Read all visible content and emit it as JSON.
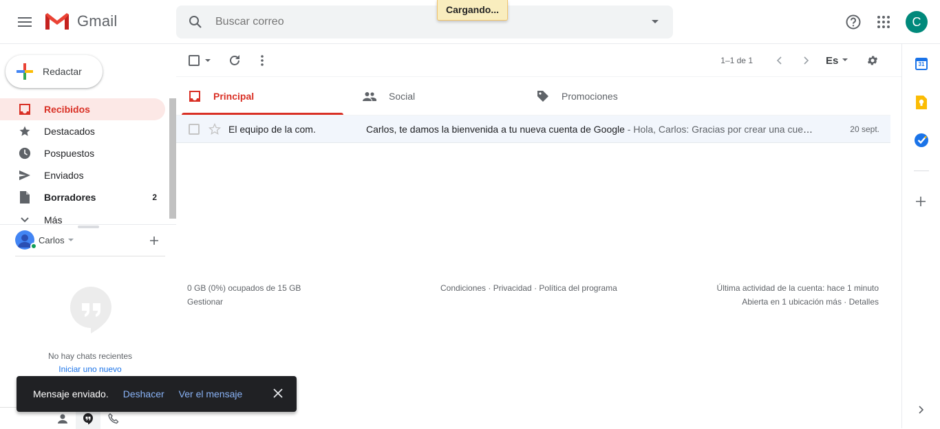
{
  "header": {
    "app_name": "Gmail",
    "search_placeholder": "Buscar correo",
    "loading": "Cargando...",
    "account_initial": "C"
  },
  "nav": {
    "compose_label": "Redactar",
    "items": [
      {
        "label": "Recibidos",
        "count": ""
      },
      {
        "label": "Destacados",
        "count": ""
      },
      {
        "label": "Pospuestos",
        "count": ""
      },
      {
        "label": "Enviados",
        "count": ""
      },
      {
        "label": "Borradores",
        "count": "2"
      },
      {
        "label": "Más",
        "count": ""
      }
    ]
  },
  "hangouts": {
    "user_name": "Carlos",
    "no_chats": "No hay chats recientes",
    "start_new": "Iniciar uno nuevo"
  },
  "toolbar": {
    "pager": "1–1 de 1",
    "lang": "Es"
  },
  "tabs": [
    {
      "label": "Principal"
    },
    {
      "label": "Social"
    },
    {
      "label": "Promociones"
    }
  ],
  "emails": [
    {
      "sender": "El equipo de la com.",
      "subject": "Carlos, te damos la bienvenida a tu nueva cuenta de Google",
      "snippet": " - Hola, Carlos: Gracias por crear una cuenta de Google.",
      "date": "20 sept."
    }
  ],
  "footer": {
    "storage": "0 GB (0%) ocupados de 15 GB",
    "manage": "Gestionar",
    "links": "Condiciones · Privacidad · Política del programa",
    "last_activity": "Última actividad de la cuenta: hace 1 minuto",
    "details": "Abierta en 1 ubicación más · Detalles"
  },
  "snackbar": {
    "message": "Mensaje enviado.",
    "undo": "Deshacer",
    "view": "Ver el mensaje"
  },
  "side_panel": {
    "calendar_day": "31"
  },
  "colors": {
    "accent_red": "#d93025",
    "active_bg": "#fce8e6",
    "link_blue": "#1a73e8",
    "snackbar_bg": "#202124",
    "snackbar_link": "#8ab4f8"
  }
}
